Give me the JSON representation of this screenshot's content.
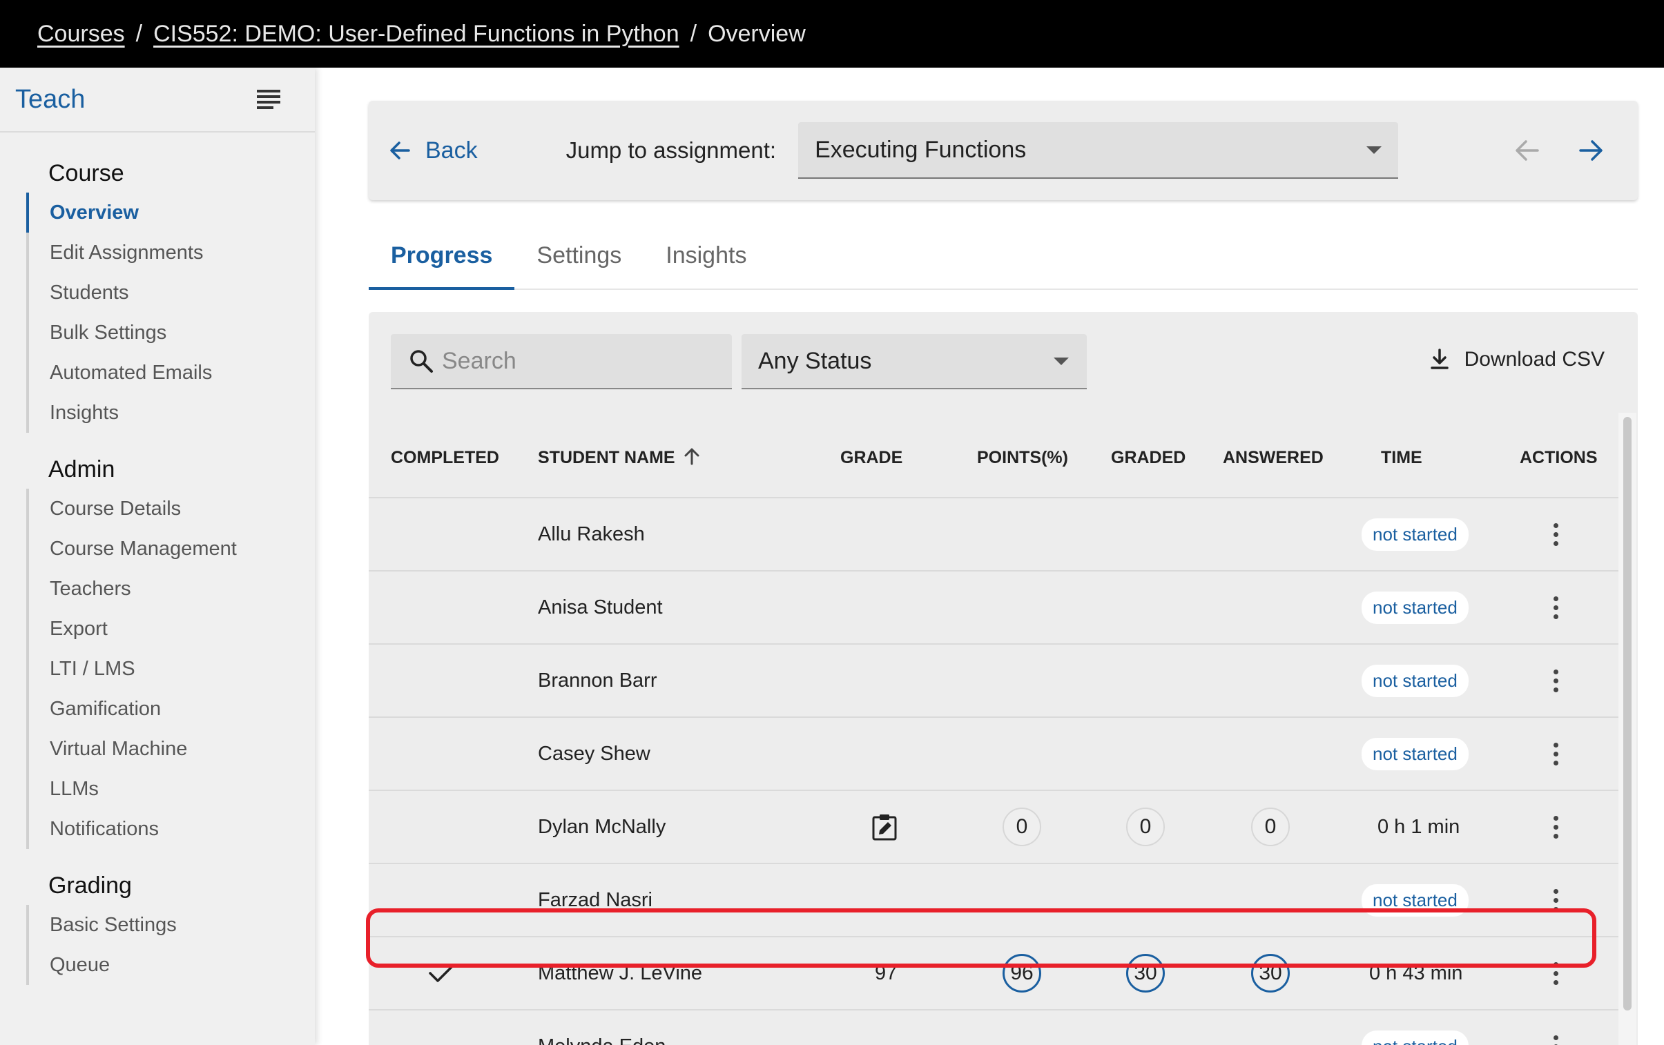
{
  "breadcrumb": {
    "items": [
      "Courses",
      "CIS552: DEMO: User-Defined Functions in Python",
      "Overview"
    ],
    "separator": "/"
  },
  "sidebar": {
    "title": "Teach",
    "sections": [
      {
        "title": "Course",
        "items": [
          "Overview",
          "Edit Assignments",
          "Students",
          "Bulk Settings",
          "Automated Emails",
          "Insights"
        ]
      },
      {
        "title": "Admin",
        "items": [
          "Course Details",
          "Course Management",
          "Teachers",
          "Export",
          "LTI / LMS",
          "Gamification",
          "Virtual Machine",
          "LLMs",
          "Notifications"
        ]
      },
      {
        "title": "Grading",
        "items": [
          "Basic Settings",
          "Queue"
        ]
      }
    ],
    "active_item": "Overview"
  },
  "assignment_bar": {
    "back_label": "Back",
    "jump_label": "Jump to assignment:",
    "selected_assignment": "Executing Functions"
  },
  "tabs": [
    "Progress",
    "Settings",
    "Insights"
  ],
  "active_tab": "Progress",
  "filters": {
    "search_placeholder": "Search",
    "status_value": "Any Status",
    "download_label": "Download CSV"
  },
  "table": {
    "columns": [
      "COMPLETED",
      "STUDENT NAME",
      "GRADE",
      "POINTS(%)",
      "GRADED",
      "ANSWERED",
      "TIME",
      "ACTIONS"
    ],
    "rows": [
      {
        "completed": false,
        "name": "Allu Rakesh",
        "status": "not started"
      },
      {
        "completed": false,
        "name": "Anisa Student",
        "status": "not started"
      },
      {
        "completed": false,
        "name": "Brannon Barr",
        "status": "not started"
      },
      {
        "completed": false,
        "name": "Casey Shew",
        "status": "not started"
      },
      {
        "completed": false,
        "name": "Dylan McNally",
        "grade_icon": "clipboard-edit-icon",
        "points": "0",
        "graded": "0",
        "answered": "0",
        "time": "0 h 1 min"
      },
      {
        "completed": false,
        "name": "Farzad Nasri",
        "status": "not started"
      },
      {
        "completed": true,
        "name": "Matthew J. LeVine",
        "grade": "97",
        "points": "96",
        "graded": "30",
        "answered": "30",
        "time": "0 h 43 min",
        "highlighted": true
      },
      {
        "completed": false,
        "name": "Melynda Eden",
        "status": "not started"
      }
    ]
  },
  "colors": {
    "accent": "#1a5fa0",
    "highlight": "#e8202a",
    "topbar": "#000000"
  }
}
